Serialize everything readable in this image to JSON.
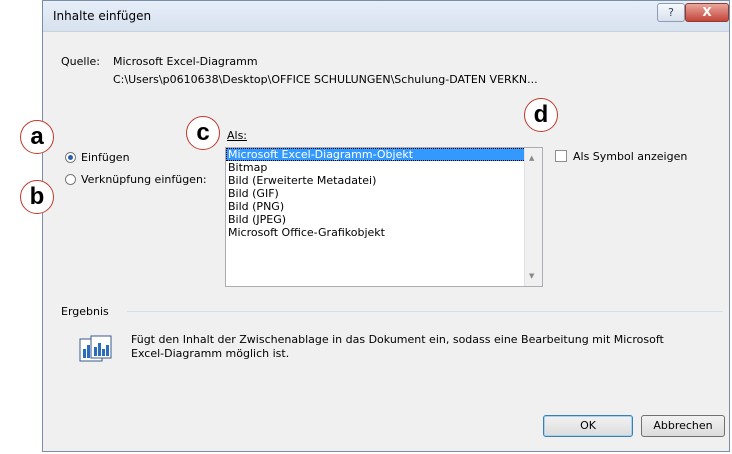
{
  "dialog": {
    "title": "Inhalte einfügen",
    "help_label": "?",
    "close_label": "X"
  },
  "source": {
    "label": "Quelle:",
    "value": "Microsoft Excel-Diagramm",
    "path": "C:\\Users\\p0610638\\Desktop\\OFFICE SCHULUNGEN\\Schulung-DATEN VERKN..."
  },
  "paste_options": {
    "as_label": "Als:",
    "radio_paste": {
      "label": "Einfügen",
      "checked": true
    },
    "radio_link": {
      "label": "Verknüpfung einfügen:",
      "checked": false
    },
    "list": [
      "Microsoft Excel-Diagramm-Objekt",
      "Bitmap",
      "Bild (Erweiterte Metadatei)",
      "Bild (GIF)",
      "Bild (PNG)",
      "Bild (JPEG)",
      "Microsoft Office-Grafikobjekt"
    ],
    "selected_index": 0,
    "symbol_checkbox": {
      "label": "Als Symbol anzeigen",
      "checked": false
    }
  },
  "result": {
    "label": "Ergebnis",
    "text_line1": "Fügt den Inhalt der Zwischenablage in das Dokument ein, sodass eine Bearbeitung mit Microsoft",
    "text_line2": "Excel-Diagramm möglich ist."
  },
  "buttons": {
    "ok": "OK",
    "cancel": "Abbrechen"
  },
  "markers": {
    "a": "a",
    "b": "b",
    "c": "c",
    "d": "d"
  }
}
